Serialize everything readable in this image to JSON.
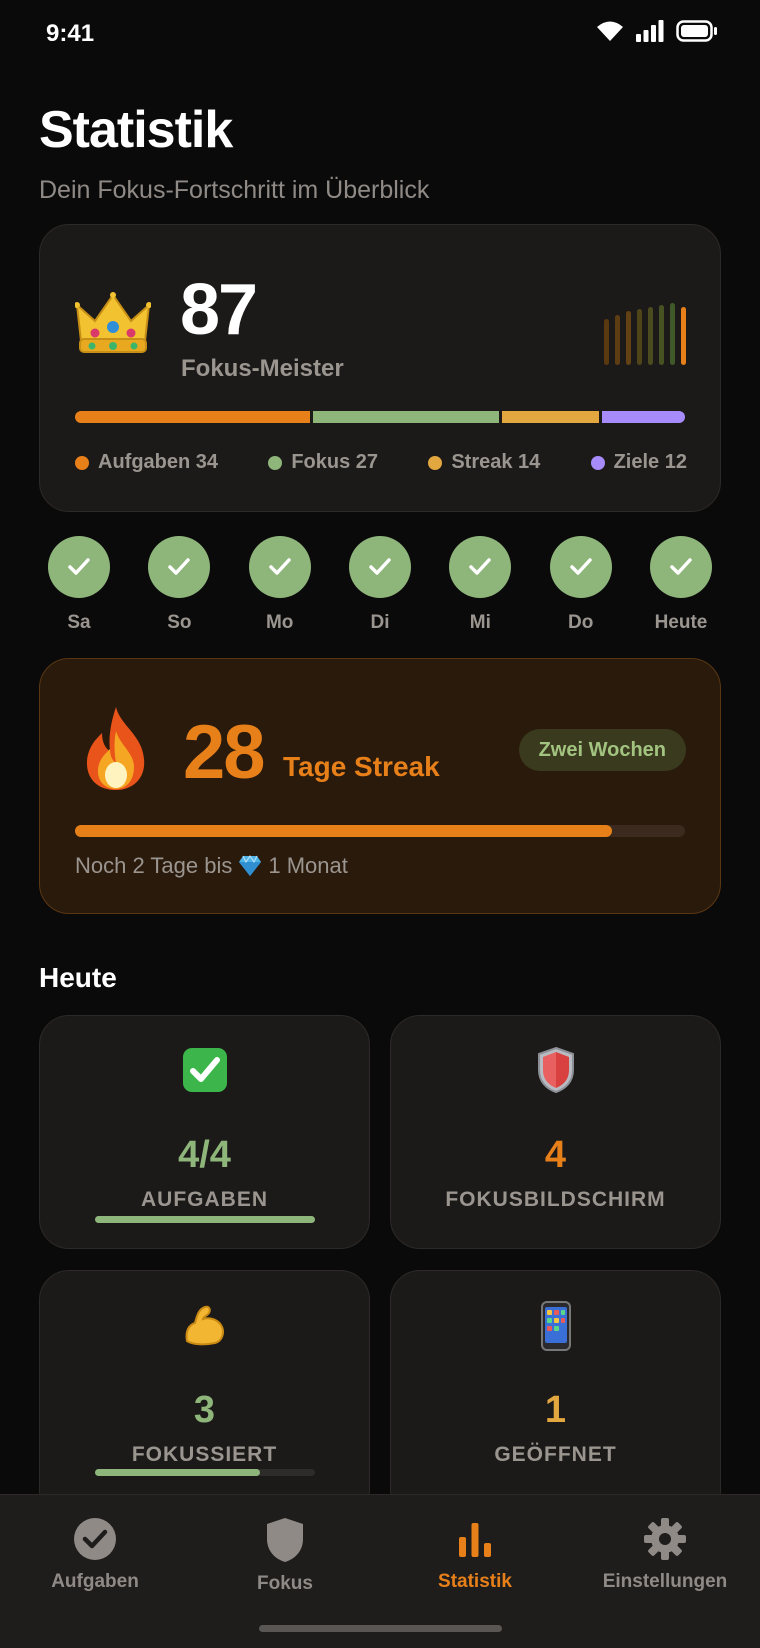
{
  "status_bar": {
    "time": "9:41"
  },
  "header": {
    "title": "Statistik",
    "subtitle": "Dein Fokus-Fortschritt im Überblick"
  },
  "score": {
    "value": "87",
    "label": "Fokus-Meister",
    "segments": [
      {
        "name": "Aufgaben",
        "value": 34,
        "color": "#e8801a"
      },
      {
        "name": "Fokus",
        "value": 27,
        "color": "#8eb57a"
      },
      {
        "name": "Streak",
        "value": 14,
        "color": "#e3a740"
      },
      {
        "name": "Ziele",
        "value": 12,
        "color": "#a78bfa"
      }
    ],
    "legend": [
      "Aufgaben 34",
      "Fokus 27",
      "Streak 14",
      "Ziele 12"
    ]
  },
  "week": {
    "days": [
      "Sa",
      "So",
      "Mo",
      "Di",
      "Mi",
      "Do",
      "Heute"
    ],
    "completed": [
      true,
      true,
      true,
      true,
      true,
      true,
      true
    ]
  },
  "streak": {
    "value": "28",
    "label": "Tage Streak",
    "badge": "Zwei Wochen",
    "progress": 0.88,
    "note_prefix": "Noch 2 Tage bis",
    "note_suffix": "1 Monat"
  },
  "today": {
    "title": "Heute",
    "cards": [
      {
        "icon": "check-box-icon",
        "value": "4/4",
        "label": "AUFGABEN",
        "color": "#8eb57a",
        "progress": 1.0
      },
      {
        "icon": "shield-icon",
        "value": "4",
        "label": "FOKUSBILDSCHIRM",
        "color": "#e8801a"
      },
      {
        "icon": "flexed-biceps-icon",
        "value": "3",
        "label": "FOKUSSIERT",
        "color": "#8eb57a",
        "progress": 0.75
      },
      {
        "icon": "mobile-phone-icon",
        "value": "1",
        "label": "GEÖFFNET",
        "color": "#e3a740"
      }
    ]
  },
  "tabs": [
    {
      "label": "Aufgaben",
      "icon": "checkmark-circle-icon",
      "active": false
    },
    {
      "label": "Fokus",
      "icon": "shield-icon",
      "active": false
    },
    {
      "label": "Statistik",
      "icon": "bar-chart-icon",
      "active": true
    },
    {
      "label": "Einstellungen",
      "icon": "gear-icon",
      "active": false
    }
  ],
  "colors": {
    "accent": "#e8801a",
    "green": "#8eb57a",
    "yellow": "#e3a740",
    "purple": "#a78bfa",
    "background": "#0b0a0a"
  }
}
